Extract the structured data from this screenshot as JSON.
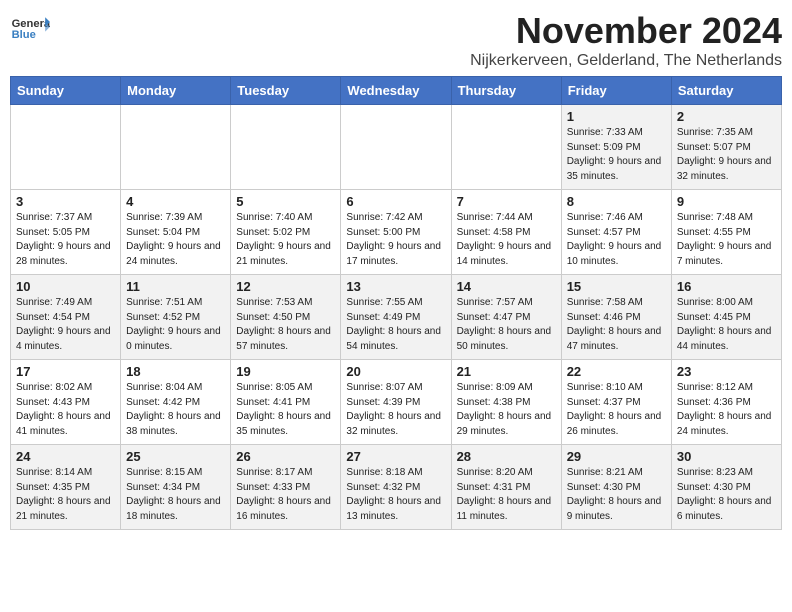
{
  "logo": {
    "general": "General",
    "blue": "Blue"
  },
  "header": {
    "month": "November 2024",
    "location": "Nijkerkerveen, Gelderland, The Netherlands"
  },
  "weekdays": [
    "Sunday",
    "Monday",
    "Tuesday",
    "Wednesday",
    "Thursday",
    "Friday",
    "Saturday"
  ],
  "weeks": [
    [
      {
        "day": "",
        "info": ""
      },
      {
        "day": "",
        "info": ""
      },
      {
        "day": "",
        "info": ""
      },
      {
        "day": "",
        "info": ""
      },
      {
        "day": "",
        "info": ""
      },
      {
        "day": "1",
        "info": "Sunrise: 7:33 AM\nSunset: 5:09 PM\nDaylight: 9 hours and 35 minutes."
      },
      {
        "day": "2",
        "info": "Sunrise: 7:35 AM\nSunset: 5:07 PM\nDaylight: 9 hours and 32 minutes."
      }
    ],
    [
      {
        "day": "3",
        "info": "Sunrise: 7:37 AM\nSunset: 5:05 PM\nDaylight: 9 hours and 28 minutes."
      },
      {
        "day": "4",
        "info": "Sunrise: 7:39 AM\nSunset: 5:04 PM\nDaylight: 9 hours and 24 minutes."
      },
      {
        "day": "5",
        "info": "Sunrise: 7:40 AM\nSunset: 5:02 PM\nDaylight: 9 hours and 21 minutes."
      },
      {
        "day": "6",
        "info": "Sunrise: 7:42 AM\nSunset: 5:00 PM\nDaylight: 9 hours and 17 minutes."
      },
      {
        "day": "7",
        "info": "Sunrise: 7:44 AM\nSunset: 4:58 PM\nDaylight: 9 hours and 14 minutes."
      },
      {
        "day": "8",
        "info": "Sunrise: 7:46 AM\nSunset: 4:57 PM\nDaylight: 9 hours and 10 minutes."
      },
      {
        "day": "9",
        "info": "Sunrise: 7:48 AM\nSunset: 4:55 PM\nDaylight: 9 hours and 7 minutes."
      }
    ],
    [
      {
        "day": "10",
        "info": "Sunrise: 7:49 AM\nSunset: 4:54 PM\nDaylight: 9 hours and 4 minutes."
      },
      {
        "day": "11",
        "info": "Sunrise: 7:51 AM\nSunset: 4:52 PM\nDaylight: 9 hours and 0 minutes."
      },
      {
        "day": "12",
        "info": "Sunrise: 7:53 AM\nSunset: 4:50 PM\nDaylight: 8 hours and 57 minutes."
      },
      {
        "day": "13",
        "info": "Sunrise: 7:55 AM\nSunset: 4:49 PM\nDaylight: 8 hours and 54 minutes."
      },
      {
        "day": "14",
        "info": "Sunrise: 7:57 AM\nSunset: 4:47 PM\nDaylight: 8 hours and 50 minutes."
      },
      {
        "day": "15",
        "info": "Sunrise: 7:58 AM\nSunset: 4:46 PM\nDaylight: 8 hours and 47 minutes."
      },
      {
        "day": "16",
        "info": "Sunrise: 8:00 AM\nSunset: 4:45 PM\nDaylight: 8 hours and 44 minutes."
      }
    ],
    [
      {
        "day": "17",
        "info": "Sunrise: 8:02 AM\nSunset: 4:43 PM\nDaylight: 8 hours and 41 minutes."
      },
      {
        "day": "18",
        "info": "Sunrise: 8:04 AM\nSunset: 4:42 PM\nDaylight: 8 hours and 38 minutes."
      },
      {
        "day": "19",
        "info": "Sunrise: 8:05 AM\nSunset: 4:41 PM\nDaylight: 8 hours and 35 minutes."
      },
      {
        "day": "20",
        "info": "Sunrise: 8:07 AM\nSunset: 4:39 PM\nDaylight: 8 hours and 32 minutes."
      },
      {
        "day": "21",
        "info": "Sunrise: 8:09 AM\nSunset: 4:38 PM\nDaylight: 8 hours and 29 minutes."
      },
      {
        "day": "22",
        "info": "Sunrise: 8:10 AM\nSunset: 4:37 PM\nDaylight: 8 hours and 26 minutes."
      },
      {
        "day": "23",
        "info": "Sunrise: 8:12 AM\nSunset: 4:36 PM\nDaylight: 8 hours and 24 minutes."
      }
    ],
    [
      {
        "day": "24",
        "info": "Sunrise: 8:14 AM\nSunset: 4:35 PM\nDaylight: 8 hours and 21 minutes."
      },
      {
        "day": "25",
        "info": "Sunrise: 8:15 AM\nSunset: 4:34 PM\nDaylight: 8 hours and 18 minutes."
      },
      {
        "day": "26",
        "info": "Sunrise: 8:17 AM\nSunset: 4:33 PM\nDaylight: 8 hours and 16 minutes."
      },
      {
        "day": "27",
        "info": "Sunrise: 8:18 AM\nSunset: 4:32 PM\nDaylight: 8 hours and 13 minutes."
      },
      {
        "day": "28",
        "info": "Sunrise: 8:20 AM\nSunset: 4:31 PM\nDaylight: 8 hours and 11 minutes."
      },
      {
        "day": "29",
        "info": "Sunrise: 8:21 AM\nSunset: 4:30 PM\nDaylight: 8 hours and 9 minutes."
      },
      {
        "day": "30",
        "info": "Sunrise: 8:23 AM\nSunset: 4:30 PM\nDaylight: 8 hours and 6 minutes."
      }
    ]
  ]
}
